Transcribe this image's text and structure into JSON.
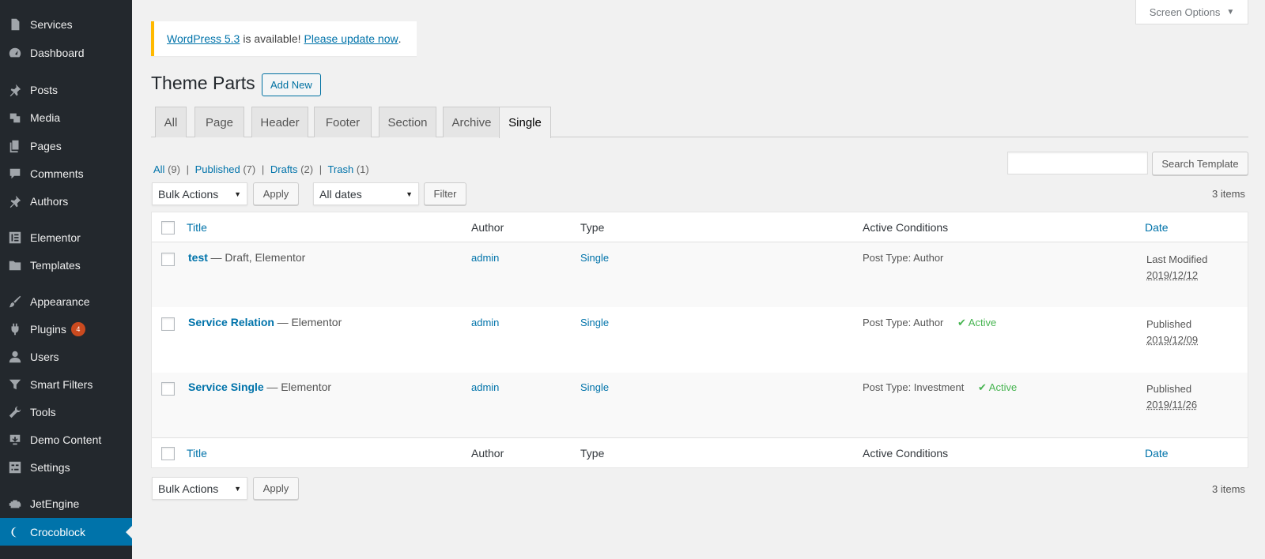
{
  "sidebar": {
    "items": [
      {
        "label": "Services",
        "icon": "page-icon"
      },
      {
        "label": "Dashboard",
        "icon": "dashboard-icon"
      },
      {
        "label": "Posts",
        "icon": "pin-icon"
      },
      {
        "label": "Media",
        "icon": "media-icon"
      },
      {
        "label": "Pages",
        "icon": "pages-icon"
      },
      {
        "label": "Comments",
        "icon": "comment-icon"
      },
      {
        "label": "Authors",
        "icon": "pin-icon"
      },
      {
        "label": "Elementor",
        "icon": "elementor-icon"
      },
      {
        "label": "Templates",
        "icon": "folder-icon"
      },
      {
        "label": "Appearance",
        "icon": "brush-icon"
      },
      {
        "label": "Plugins",
        "icon": "plugin-icon",
        "badge": "4"
      },
      {
        "label": "Users",
        "icon": "user-icon"
      },
      {
        "label": "Smart Filters",
        "icon": "filter-icon"
      },
      {
        "label": "Tools",
        "icon": "wrench-icon"
      },
      {
        "label": "Demo Content",
        "icon": "download-icon"
      },
      {
        "label": "Settings",
        "icon": "settings-icon"
      },
      {
        "label": "JetEngine",
        "icon": "engine-icon"
      },
      {
        "label": "Crocoblock",
        "icon": "crocoblock-icon",
        "current": true
      }
    ]
  },
  "header": {
    "screen_options": "Screen Options"
  },
  "notice": {
    "version_link": "WordPress 5.3",
    "middle_text": "is available!",
    "update_link": "Please update now",
    "end": "."
  },
  "page": {
    "title": "Theme Parts",
    "add_new": "Add New"
  },
  "tabs": [
    "All",
    "Page",
    "Header",
    "Footer",
    "Section",
    "Archive",
    "Single"
  ],
  "active_tab": "Single",
  "filters": {
    "all": "All",
    "all_count": "(9)",
    "published": "Published",
    "published_count": "(7)",
    "drafts": "Drafts",
    "drafts_count": "(2)",
    "trash": "Trash",
    "trash_count": "(1)",
    "separator": "|"
  },
  "search": {
    "button": "Search Template",
    "value": ""
  },
  "toolbar": {
    "bulk_actions": "Bulk Actions",
    "apply": "Apply",
    "all_dates": "All dates",
    "filter": "Filter",
    "items_count": "3 items"
  },
  "table": {
    "columns": {
      "title": "Title",
      "author": "Author",
      "type": "Type",
      "conditions": "Active Conditions",
      "date": "Date"
    },
    "rows": [
      {
        "title": "test",
        "meta": "— Draft, Elementor",
        "author": "admin",
        "type": "Single",
        "conditions": "Post Type: Author",
        "active": "",
        "date_status": "Last Modified",
        "date": "2019/12/12"
      },
      {
        "title": "Service Relation",
        "meta": "— Elementor",
        "author": "admin",
        "type": "Single",
        "conditions": "Post Type: Author",
        "active": "✔ Active",
        "date_status": "Published",
        "date": "2019/12/09"
      },
      {
        "title": "Service Single",
        "meta": "— Elementor",
        "author": "admin",
        "type": "Single",
        "conditions": "Post Type: Investment",
        "active": "✔ Active",
        "date_status": "Published",
        "date": "2019/11/26"
      }
    ]
  },
  "colors": {
    "sidebar_bg": "#23282d",
    "accent": "#0073aa",
    "notice_border": "#ffb900",
    "active_green": "#46b450",
    "badge": "#ca4a1f"
  }
}
